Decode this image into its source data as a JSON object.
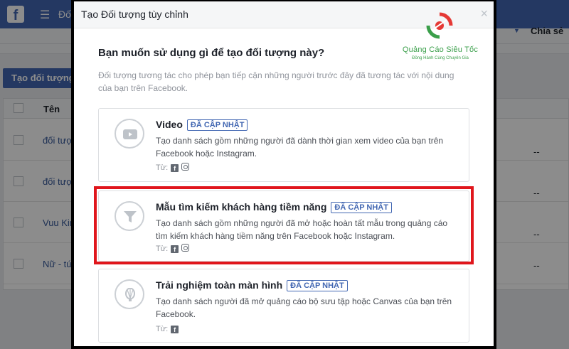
{
  "background": {
    "topbar_title": "Đố",
    "create_button": "Tạo đối tượng",
    "table": {
      "col_name": "Tên",
      "col_share": "Chia sẻ",
      "rows": [
        {
          "name": "đối tượ",
          "share": "--"
        },
        {
          "name": "đối tượ",
          "share": "--"
        },
        {
          "name": "Vuu Kin",
          "share": "--"
        },
        {
          "name": "Nữ - tứ",
          "share": "--"
        }
      ]
    }
  },
  "modal": {
    "title": "Tạo Đối tượng tùy chỉnh",
    "close": "×",
    "question": "Bạn muốn sử dụng gì để tạo đối tượng này?",
    "description": "Đối tượng tương tác cho phép bạn tiếp cận những người trước đây đã tương tác với nội dung của bạn trên Facebook.",
    "watermark": {
      "name": "Quảng Cáo Siêu Tốc",
      "tagline": "Đồng Hành Cùng Chuyên Gia"
    },
    "options": [
      {
        "title": "Video",
        "badge": "ĐÃ CẬP NHẬT",
        "body": "Tạo danh sách gồm những người đã dành thời gian xem video của bạn trên Facebook hoặc Instagram.",
        "from": "Từ:",
        "icon": "play-icon"
      },
      {
        "title": "Mẫu tìm kiếm khách hàng tiềm năng",
        "badge": "ĐÃ CẬP NHẬT",
        "body": "Tạo danh sách gồm những người đã mở hoặc hoàn tất mẫu trong quảng cáo tìm kiếm khách hàng tiềm năng trên Facebook hoặc Instagram.",
        "from": "Từ:",
        "icon": "filter-icon"
      },
      {
        "title": "Trải nghiệm toàn màn hình",
        "badge": "ĐÃ CẬP NHẬT",
        "body": "Tạo danh sách người đã mở quảng cáo bộ sưu tập hoặc Canvas của bạn trên Facebook.",
        "from": "Từ:",
        "icon": "balloon-icon"
      }
    ]
  },
  "colors": {
    "facebook_blue": "#4267b2",
    "highlight_red": "#e0161c",
    "logo_green": "#3a9f4a"
  }
}
